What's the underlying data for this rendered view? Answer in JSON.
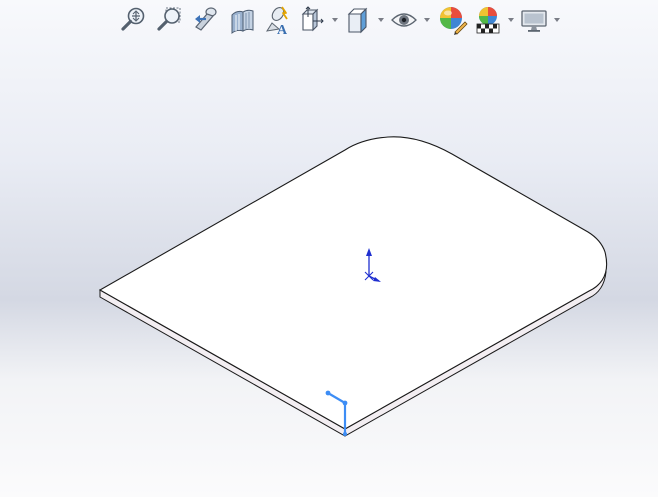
{
  "hud_toolbar": {
    "buttons": [
      {
        "id": "zoom-to-fit",
        "icon": "zoom-to-fit-icon",
        "has_dropdown": false
      },
      {
        "id": "zoom-to-area",
        "icon": "zoom-to-area-icon",
        "has_dropdown": false
      },
      {
        "id": "previous-view",
        "icon": "previous-view-icon",
        "has_dropdown": false
      },
      {
        "id": "section-view",
        "icon": "section-view-icon",
        "has_dropdown": false
      },
      {
        "id": "dynamic-annotation-views",
        "icon": "dynamic-annotation-icon",
        "has_dropdown": false
      },
      {
        "id": "view-orientation",
        "icon": "view-orientation-icon",
        "has_dropdown": true
      },
      {
        "id": "display-style",
        "icon": "display-style-icon",
        "has_dropdown": true
      },
      {
        "id": "hide-show-items",
        "icon": "hide-show-eye-icon",
        "has_dropdown": true
      },
      {
        "id": "edit-appearance",
        "icon": "edit-appearance-icon",
        "has_dropdown": false
      },
      {
        "id": "apply-scene",
        "icon": "apply-scene-icon",
        "has_dropdown": true
      },
      {
        "id": "view-settings",
        "icon": "view-settings-monitor-icon",
        "has_dropdown": true
      }
    ]
  },
  "colors": {
    "part_face": "#ffffff",
    "part_edge": "#1a1a1a",
    "part_side": "#f3eef2",
    "origin_indicator": "#1f2fd0",
    "triad": "#3d8df5",
    "toolbar_icon_blue": "#6a8fb8"
  }
}
